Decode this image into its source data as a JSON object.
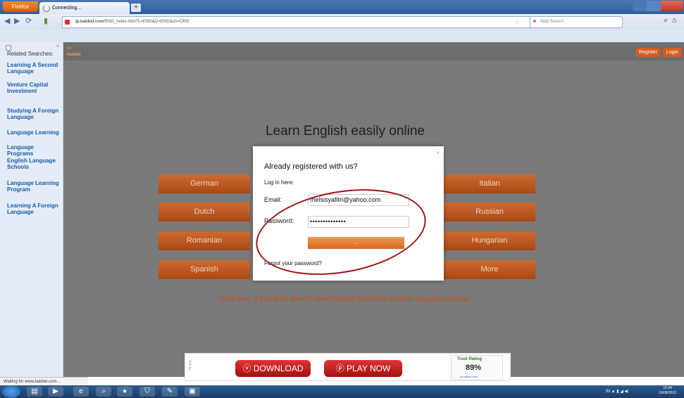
{
  "browser": {
    "menu_label": "Firefox",
    "tab_title": "Connecting...",
    "new_tab": "+",
    "url_site": "lp.babbel.com",
    "url_path": "/ENG_index.html?L=ENG&l2=ENG&ch=ORG",
    "search_placeholder": "Web Search",
    "status_text": "Waiting for www.babbel.com..."
  },
  "sidebar": {
    "heading": "Related Searches:",
    "links": [
      "Learning A Second Language",
      "Venture Capital Investment",
      "Studying A Foreign Language",
      "Language Learning",
      "Language Programs",
      "English Language Schools",
      "Language Learning Program",
      "Learning A Foreign Language"
    ]
  },
  "site": {
    "logo": "babbel",
    "register": "Register",
    "login": "Login",
    "headline": "Learn English easily online",
    "languages_left": [
      "German",
      "Dutch",
      "Romanian",
      "Spanish"
    ],
    "languages_right": [
      "Italian",
      "Russian",
      "Hungarian",
      "More"
    ],
    "cta": "Click here, if you don't want to learn English but rather another language instead."
  },
  "modal": {
    "title": "Already registered with us?",
    "subtitle": "Log in here:",
    "email_label": "Email:",
    "email_value": "melsisyafitri@yahoo.com",
    "password_label": "Password:",
    "password_value": "••••••••••••••",
    "submit_label": "...",
    "forgot": "Forgot your password?",
    "close": "×"
  },
  "ad": {
    "tag": "Ads by",
    "download": "DOWNLOAD",
    "play": "PLAY NOW",
    "trust_title": "Trust Rating",
    "trust_value": "89%",
    "trust_site": "lp.babbel.com"
  },
  "taskbar": {
    "clock_time": "15:34",
    "clock_date": "10/08/2013",
    "tray_lang": "IN"
  }
}
